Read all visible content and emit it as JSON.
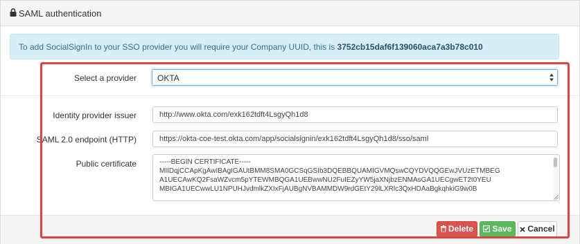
{
  "panel": {
    "title": "SAML authentication",
    "title_icon": "lock-icon"
  },
  "alert": {
    "prefix": "To add SocialSignIn to your SSO provider you will require your Company UUID, this is ",
    "uuid": "3752cb15daf6f139060aca7a3b78c010"
  },
  "form": {
    "provider": {
      "label": "Select a provider",
      "value": "OKTA"
    },
    "issuer": {
      "label": "Identity provider issuer",
      "value": "http://www.okta.com/exk162tdft4LsgyQh1d8"
    },
    "endpoint": {
      "label": "SAML 2.0 endpoint (HTTP)",
      "value": "https://okta-coe-test.okta.com/app/socialsignin/exk162tdft4LsgyQh1d8/sso/saml"
    },
    "certificate": {
      "label": "Public certificate",
      "lines": [
        "-----BEGIN CERTIFICATE-----",
        "MIIDqjCCApKgAwIBAgIGAUtBMM8SMA0GCSqGSIb3DQEBBQUAMIGVMQswCQYDVQQGEwJVUzETMBEG",
        "A1UECAwKQ2FsaWZvcm5pYTEWMBQGA1UEBwwNU2FuIEZyYW5jaXNjbzENMAsGA1UECgwET2t0YEU",
        "MBIGA1UECwwLU1NPUHJvdmlkZXIxFjAUBgNVBAMMDW9rdGEtY29lLXRlc3QxHDAaBgkqhkiG9w0B"
      ]
    }
  },
  "buttons": {
    "delete": "Delete",
    "save": "Save",
    "cancel": "Cancel"
  },
  "colors": {
    "annotation_border": "#e0443e",
    "alert_bg": "#d9edf7",
    "danger": "#d9534f",
    "success": "#5cb85c"
  }
}
